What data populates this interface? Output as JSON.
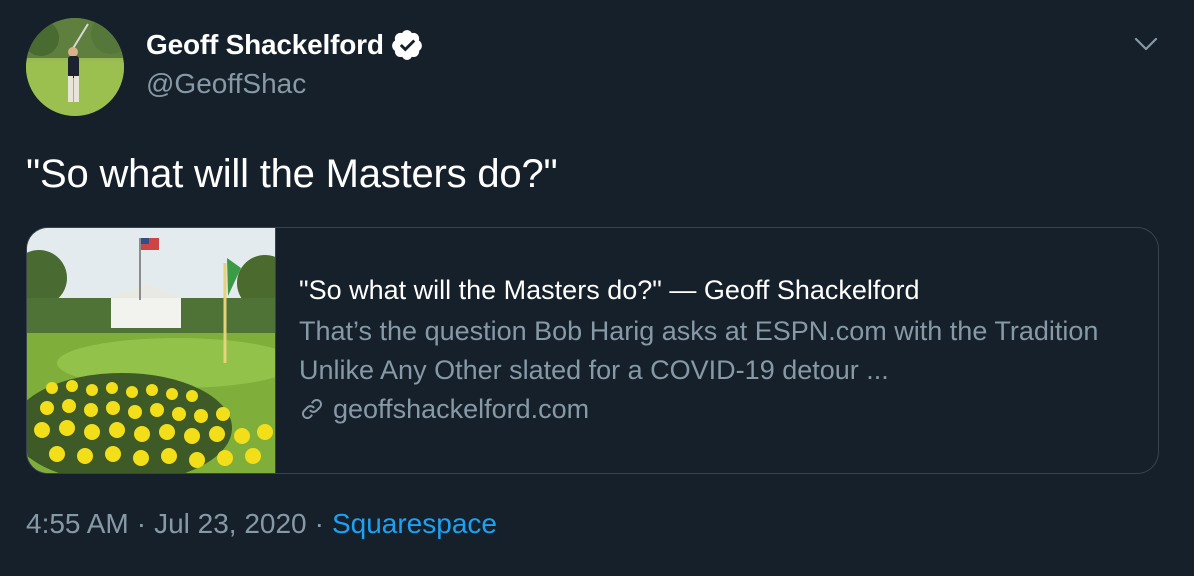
{
  "author": {
    "display_name": "Geoff Shackelford",
    "handle": "@GeoffShac",
    "verified": true
  },
  "tweet": {
    "text": "\"So what will the Masters do?\""
  },
  "card": {
    "title": "\"So what will the Masters do?\" — Geoff Shackelford",
    "description": "That’s the question Bob Harig asks at ESPN.com with the Tradition Unlike Any Other slated for a COVID-19 detour ...",
    "domain": "geoffshackelford.com"
  },
  "footer": {
    "time": "4:55 AM",
    "date": "Jul 23, 2020",
    "separator": "·",
    "source": "Squarespace"
  },
  "icons": {
    "verified": "verified-badge-icon",
    "caret": "chevron-down-icon",
    "link": "link-icon"
  },
  "colors": {
    "background": "#15202b",
    "secondary_text": "#8899a6",
    "accent": "#1da1f2",
    "border": "#38444d"
  }
}
